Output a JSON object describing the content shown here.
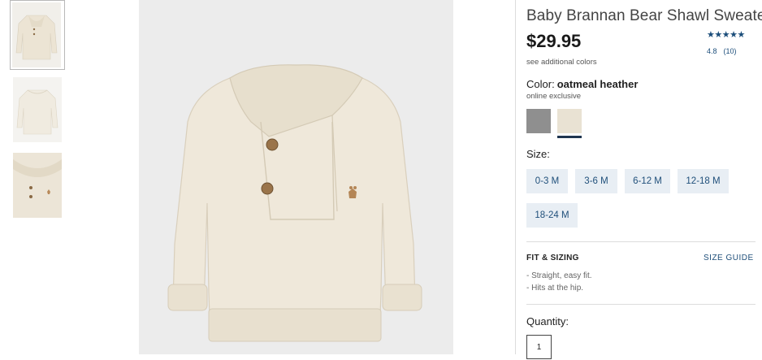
{
  "product": {
    "title": "Baby Brannan Bear Shawl Sweater",
    "price": "$29.95",
    "stars": "★★★★★",
    "rating": "4.8",
    "review_count": "(10)",
    "see_colors": "see additional colors",
    "color_label": "Color:",
    "color_value": "oatmeal heather",
    "online_exclusive": "online exclusive",
    "swatches": [
      {
        "name": "grey",
        "color": "#8f8f8f"
      },
      {
        "name": "oatmeal heather",
        "color": "#e9e2d3",
        "selected": true
      }
    ],
    "size_label": "Size:",
    "sizes": [
      "0-3 M",
      "3-6 M",
      "6-12 M",
      "12-18 M",
      "18-24 M"
    ],
    "fit_title": "FIT & SIZING",
    "size_guide": "SIZE GUIDE",
    "fit_items": [
      "- Straight, easy fit.",
      "- Hits at the hip."
    ],
    "quantity_label": "Quantity:",
    "quantity_value": "1"
  },
  "colors": {
    "accent": "#1f4f7a",
    "size_button_bg": "#e8eef4",
    "sweater": "#efe8da"
  }
}
